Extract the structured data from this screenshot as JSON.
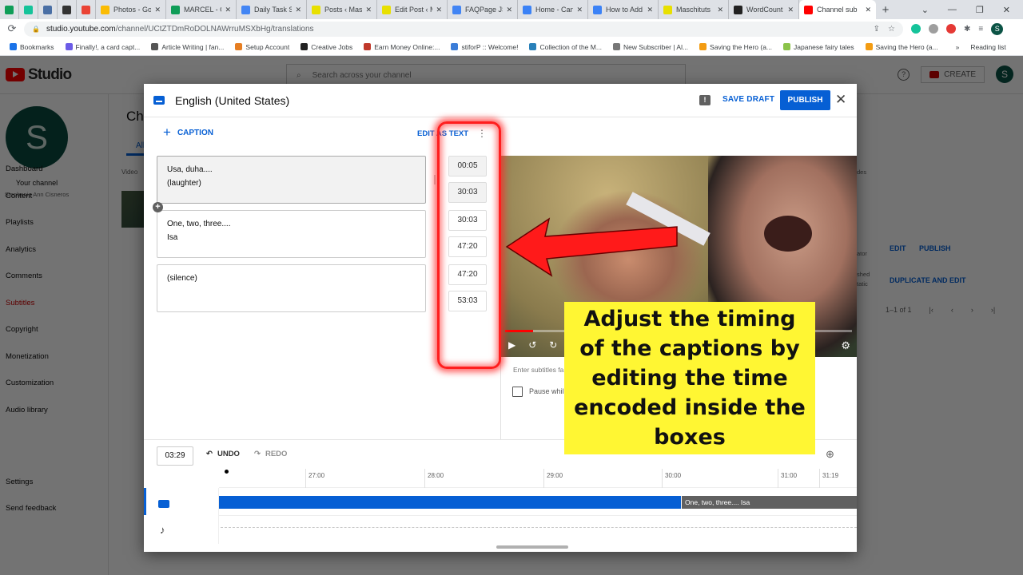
{
  "browser": {
    "tabs": [
      {
        "label": "",
        "icon": "sheets-icon",
        "color": "#0f9d58",
        "pinned": true
      },
      {
        "label": "",
        "icon": "grammarly-icon",
        "color": "#15c39a",
        "pinned": true
      },
      {
        "label": "",
        "icon": "app-icon",
        "color": "#4a6fa5",
        "pinned": true
      },
      {
        "label": "",
        "icon": "h-icon",
        "color": "#333333",
        "pinned": true
      },
      {
        "label": "",
        "icon": "gmail-icon",
        "color": "#ea4335",
        "pinned": true
      },
      {
        "label": "Photos - Go",
        "icon": "photos-icon",
        "color": "#fbbc04"
      },
      {
        "label": "MARCEL - G",
        "icon": "drive-icon",
        "color": "#0f9d58"
      },
      {
        "label": "Daily Task S",
        "icon": "docs-icon",
        "color": "#4285f4"
      },
      {
        "label": "Posts ‹ Mas",
        "icon": "mt-icon",
        "color": "#e8e000"
      },
      {
        "label": "Edit Post ‹ M",
        "icon": "mt-icon",
        "color": "#e8e000"
      },
      {
        "label": "FAQPage JS",
        "icon": "json-icon",
        "color": "#4285f4"
      },
      {
        "label": "Home - Can",
        "icon": "canva-icon",
        "color": "#3b82f6"
      },
      {
        "label": "How to Add",
        "icon": "canva-icon",
        "color": "#3b82f6"
      },
      {
        "label": "Maschituts",
        "icon": "mt-icon",
        "color": "#e8e000"
      },
      {
        "label": "WordCount",
        "icon": "w-icon",
        "color": "#222222"
      },
      {
        "label": "Channel sub",
        "icon": "youtube-icon",
        "color": "#ff0000",
        "active": true
      }
    ],
    "url_host": "studio.youtube.com",
    "url_path": "/channel/UCtZTDmRoDOLNAWrruMSXbHg/translations",
    "bookmarks": [
      {
        "label": "Bookmarks",
        "icon": "star-icon",
        "color": "#1a73e8"
      },
      {
        "label": "Finally!, a card capt...",
        "icon": "bookmark-icon",
        "color": "#6c5ce7"
      },
      {
        "label": "Article Writing | fan...",
        "icon": "globe-icon",
        "color": "#555555"
      },
      {
        "label": "Setup Account",
        "icon": "account-icon",
        "color": "#e67e22"
      },
      {
        "label": "Creative Jobs",
        "icon": "cj-icon",
        "color": "#222222"
      },
      {
        "label": "Earn Money Online:...",
        "icon": "d-icon",
        "color": "#c0392b"
      },
      {
        "label": "stiforP :: Welcome!",
        "icon": "page-icon",
        "color": "#3b7dd8"
      },
      {
        "label": "Collection of the M...",
        "icon": "u-icon",
        "color": "#2980b9"
      },
      {
        "label": "New Subscriber | Al...",
        "icon": "mountain-icon",
        "color": "#777777"
      },
      {
        "label": "Saving the Hero (a...",
        "icon": "book-icon",
        "color": "#f39c12"
      },
      {
        "label": "Japanese fairy tales",
        "icon": "leaf-icon",
        "color": "#8bc34a"
      },
      {
        "label": "Saving the Hero (a...",
        "icon": "book-icon",
        "color": "#f39c12"
      }
    ],
    "more_bookmarks": "»",
    "reading_list": "Reading list",
    "profile_initial": "S"
  },
  "studio": {
    "logo_text": "Studio",
    "search_placeholder": "Search across your channel",
    "create_label": "CREATE",
    "avatar_initial": "S",
    "channel_avatar_initial": "S",
    "your_channel": "Your channel",
    "channel_name": "Stephanie Ann Cisneros",
    "nav": [
      {
        "label": "Dashboard"
      },
      {
        "label": "Content"
      },
      {
        "label": "Playlists"
      },
      {
        "label": "Analytics"
      },
      {
        "label": "Comments"
      },
      {
        "label": "Subtitles",
        "active": true
      },
      {
        "label": "Copyright"
      },
      {
        "label": "Monetization"
      },
      {
        "label": "Customization"
      },
      {
        "label": "Audio library"
      }
    ],
    "nav_bottom": [
      {
        "label": "Settings"
      },
      {
        "label": "Send feedback"
      }
    ],
    "page_title": "Cha",
    "tab_all": "All",
    "col_video": "Video",
    "col_partial": "des",
    "row_actions": {
      "edit": "EDIT",
      "publish": "PUBLISH",
      "duplicate": "DUPLICATE AND EDIT"
    },
    "row_partial_1": "ator",
    "row_partial_2": "shed",
    "row_partial_3": "tatic",
    "pagination": "1–1 of 1"
  },
  "editor": {
    "title": "English (United States)",
    "save_draft": "SAVE DRAFT",
    "publish": "PUBLISH",
    "add_caption": "CAPTION",
    "edit_as_text": "EDIT AS TEXT",
    "captions": [
      {
        "lines": [
          "Usa, duha....",
          "(laughter)"
        ],
        "start": "00:05",
        "end": "30:03",
        "selected": true
      },
      {
        "lines": [
          "One, two, three....",
          "Isa"
        ],
        "start": "30:03",
        "end": "47:20"
      },
      {
        "lines": [
          "(silence)"
        ],
        "start": "47:20",
        "end": "53:03"
      }
    ],
    "video_progress_pct": 8,
    "enter_subtitles_hint": "Enter subtitles fa",
    "pause_label": "Pause whil",
    "pause_checked": false,
    "current_time": "03:29",
    "undo": "UNDO",
    "redo": "REDO",
    "ruler_ticks": [
      "27:00",
      "28:00",
      "29:00",
      "30:00",
      "31:00",
      "31:19"
    ],
    "timeline_segments": [
      {
        "label": "",
        "type": "blue"
      },
      {
        "label": "One, two, three.... Isa",
        "type": "gray"
      }
    ]
  },
  "annotation": {
    "callout_text": "Adjust the timing of the captions by editing the time encoded inside the boxes",
    "highlight_color": "#ff1e1e",
    "callout_color": "#fff633"
  }
}
